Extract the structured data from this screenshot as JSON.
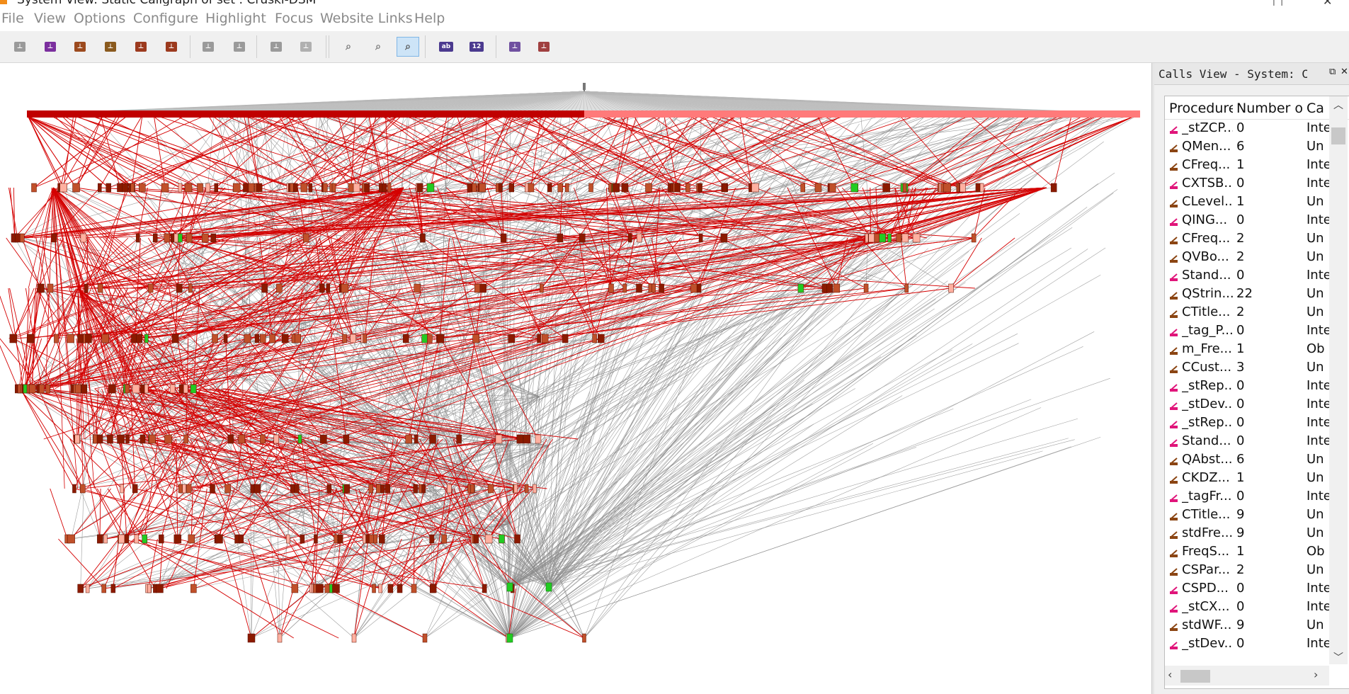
{
  "window": {
    "title": "System View: Static Callgraph of set : Cruski-DSM",
    "controls": [
      "□",
      "✕"
    ]
  },
  "menu": [
    "File",
    "View",
    "Options",
    "Configure",
    "Highlight",
    "Focus",
    "Website Links",
    "Help"
  ],
  "toolbar": {
    "buttons": [
      {
        "icon": "graph-gray-icon",
        "color": "#9a9a9a"
      },
      {
        "icon": "graph-purple-icon",
        "color": "#7b2f9e"
      },
      {
        "icon": "graph-brown-icon",
        "color": "#9c4a1e"
      },
      {
        "icon": "graph-brown-icon",
        "color": "#8a5a1e"
      },
      {
        "icon": "graph-brown-icon",
        "color": "#9c3a1e"
      },
      {
        "icon": "graph-brown-icon",
        "color": "#9c3a1e"
      },
      {
        "icon": "graph-gray-icon",
        "color": "#9a9a9a"
      },
      {
        "icon": "graph-gray-icon",
        "color": "#9a9a9a"
      },
      {
        "icon": "graph-gray-icon",
        "color": "#9a9a9a"
      },
      {
        "icon": "graph-gray-icon",
        "color": "#b0b0b0"
      },
      {
        "icon": "zoom-in-icon",
        "color": "#777777"
      },
      {
        "icon": "zoom-out-icon",
        "color": "#777777"
      },
      {
        "icon": "zoom-fit-icon",
        "color": "#555555"
      },
      {
        "icon": "text-labels-icon",
        "label": "ab",
        "color": "#4b3a8f"
      },
      {
        "icon": "number-labels-icon",
        "label": "12",
        "color": "#4b3a8f"
      },
      {
        "icon": "highlight-pen-icon",
        "color": "#7050a0"
      },
      {
        "icon": "export-icon",
        "color": "#a04040"
      }
    ]
  },
  "calls_view": {
    "title": "Calls View - System: CTa···",
    "columns": [
      "Procedure",
      "Number o",
      "Ca"
    ],
    "rows": [
      {
        "icon": "pink",
        "name": "_stZCP...",
        "num": "0",
        "cat": "Inte"
      },
      {
        "icon": "brown",
        "name": "QMen...",
        "num": "6",
        "cat": "Un"
      },
      {
        "icon": "brown",
        "name": "CFreq...",
        "num": "1",
        "cat": "Inte"
      },
      {
        "icon": "pink",
        "name": "CXTSB...",
        "num": "0",
        "cat": "Inte"
      },
      {
        "icon": "brown",
        "name": "CLevel...",
        "num": "1",
        "cat": "Un"
      },
      {
        "icon": "pink",
        "name": "QING...",
        "num": "0",
        "cat": "Inte"
      },
      {
        "icon": "brown",
        "name": "CFreq...",
        "num": "2",
        "cat": "Un"
      },
      {
        "icon": "brown",
        "name": "QVBo...",
        "num": "2",
        "cat": "Un"
      },
      {
        "icon": "pink",
        "name": "Stand...",
        "num": "0",
        "cat": "Inte"
      },
      {
        "icon": "brown",
        "name": "QStrin...",
        "num": "22",
        "cat": "Un"
      },
      {
        "icon": "brown",
        "name": "CTitle...",
        "num": "2",
        "cat": "Un"
      },
      {
        "icon": "pink",
        "name": "_tag_P...",
        "num": "0",
        "cat": "Inte"
      },
      {
        "icon": "brown",
        "name": "m_Fre...",
        "num": "1",
        "cat": "Ob"
      },
      {
        "icon": "brown",
        "name": "CCust...",
        "num": "3",
        "cat": "Un"
      },
      {
        "icon": "pink",
        "name": "_stRep...",
        "num": "0",
        "cat": "Inte"
      },
      {
        "icon": "pink",
        "name": "_stDev...",
        "num": "0",
        "cat": "Inte"
      },
      {
        "icon": "pink",
        "name": "_stRep...",
        "num": "0",
        "cat": "Inte"
      },
      {
        "icon": "pink",
        "name": "Stand...",
        "num": "0",
        "cat": "Inte"
      },
      {
        "icon": "brown",
        "name": "QAbst...",
        "num": "6",
        "cat": "Un"
      },
      {
        "icon": "brown",
        "name": "CKDZ...",
        "num": "1",
        "cat": "Un"
      },
      {
        "icon": "pink",
        "name": "_tagFr...",
        "num": "0",
        "cat": "Inte"
      },
      {
        "icon": "brown",
        "name": "CTitle...",
        "num": "9",
        "cat": "Un"
      },
      {
        "icon": "brown",
        "name": "stdFre...",
        "num": "9",
        "cat": "Un"
      },
      {
        "icon": "brown",
        "name": "FreqS...",
        "num": "1",
        "cat": "Ob"
      },
      {
        "icon": "brown",
        "name": "CSPar...",
        "num": "2",
        "cat": "Un"
      },
      {
        "icon": "pink",
        "name": "CSPD...",
        "num": "0",
        "cat": "Inte"
      },
      {
        "icon": "pink",
        "name": "_stCX...",
        "num": "0",
        "cat": "Inte"
      },
      {
        "icon": "brown",
        "name": "stdWF...",
        "num": "9",
        "cat": "Un"
      },
      {
        "icon": "pink",
        "name": "_stDev...",
        "num": "0",
        "cat": "Inte"
      }
    ]
  },
  "colors": {
    "call_edge": "#d40000",
    "other_edge": "#8c8c8c",
    "node_dark": "#8b1a00",
    "node_light": "#ffb0a0",
    "node_green": "#22cc22",
    "top_bar": "#c00000",
    "top_bar_light": "#ff7a7a"
  }
}
